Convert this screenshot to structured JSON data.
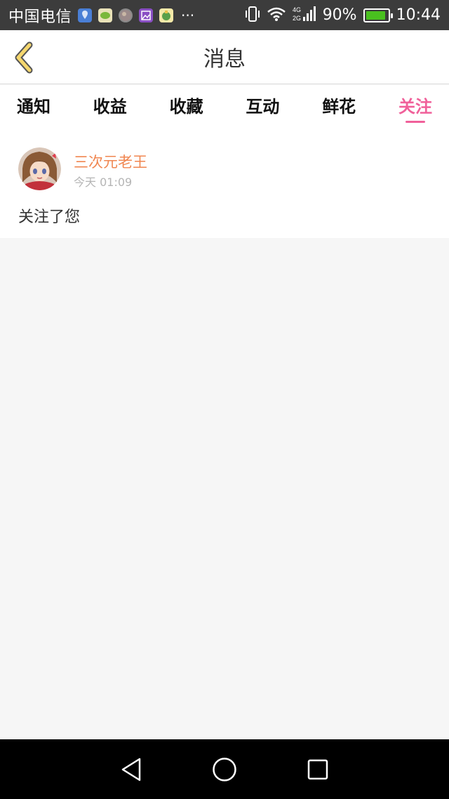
{
  "status_bar": {
    "carrier": "中国电信",
    "battery_percent": "90%",
    "battery_level": 0.9,
    "time": "10:44",
    "network": "4G 2G",
    "notification_icons": [
      "location-app-icon",
      "chat-app-icon",
      "photo-app-icon",
      "gallery-app-icon",
      "finance-app-icon"
    ],
    "overflow": "···"
  },
  "header": {
    "title": "消息",
    "back_icon": "chevron-left-icon",
    "accent_color": "#f5d76e"
  },
  "tabs": [
    {
      "label": "通知",
      "active": false
    },
    {
      "label": "收益",
      "active": false
    },
    {
      "label": "收藏",
      "active": false
    },
    {
      "label": "互动",
      "active": false
    },
    {
      "label": "鲜花",
      "active": false
    },
    {
      "label": "关注",
      "active": true
    }
  ],
  "tab_active_color": "#f0609a",
  "messages": [
    {
      "sender": "三次元老王",
      "time": "今天 01:09",
      "text": "关注了您",
      "avatar_icon": "anime-girl-avatar"
    }
  ],
  "nav_bar": {
    "buttons": [
      "back-triangle-icon",
      "home-circle-icon",
      "recents-square-icon"
    ]
  }
}
